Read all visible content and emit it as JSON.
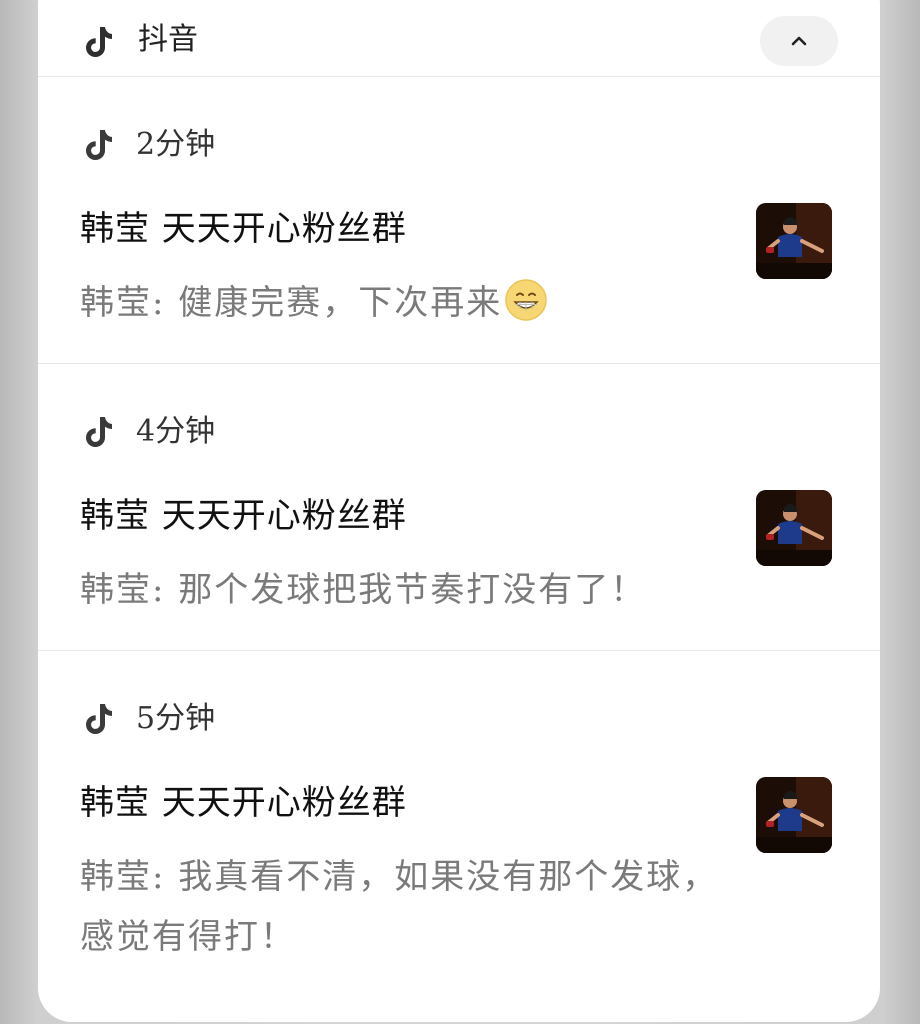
{
  "app": {
    "name": "抖音"
  },
  "notifications": [
    {
      "time": "2分钟",
      "title": "韩莹 天天开心粉丝群",
      "body": "韩莹: 健康完赛，下次再来",
      "emoji": "grinning-face-emoji"
    },
    {
      "time": "4分钟",
      "title": "韩莹 天天开心粉丝群",
      "body": "韩莹: 那个发球把我节奏打没有了！"
    },
    {
      "time": "5分钟",
      "title": "韩莹 天天开心粉丝群",
      "body": "韩莹: 我真看不清，如果没有那个发球， 感觉有得打！"
    }
  ],
  "colors": {
    "card_bg": "#ffffff",
    "title_text": "#111111",
    "body_text": "#7a7a7a",
    "button_bg": "#f1f1f1"
  }
}
